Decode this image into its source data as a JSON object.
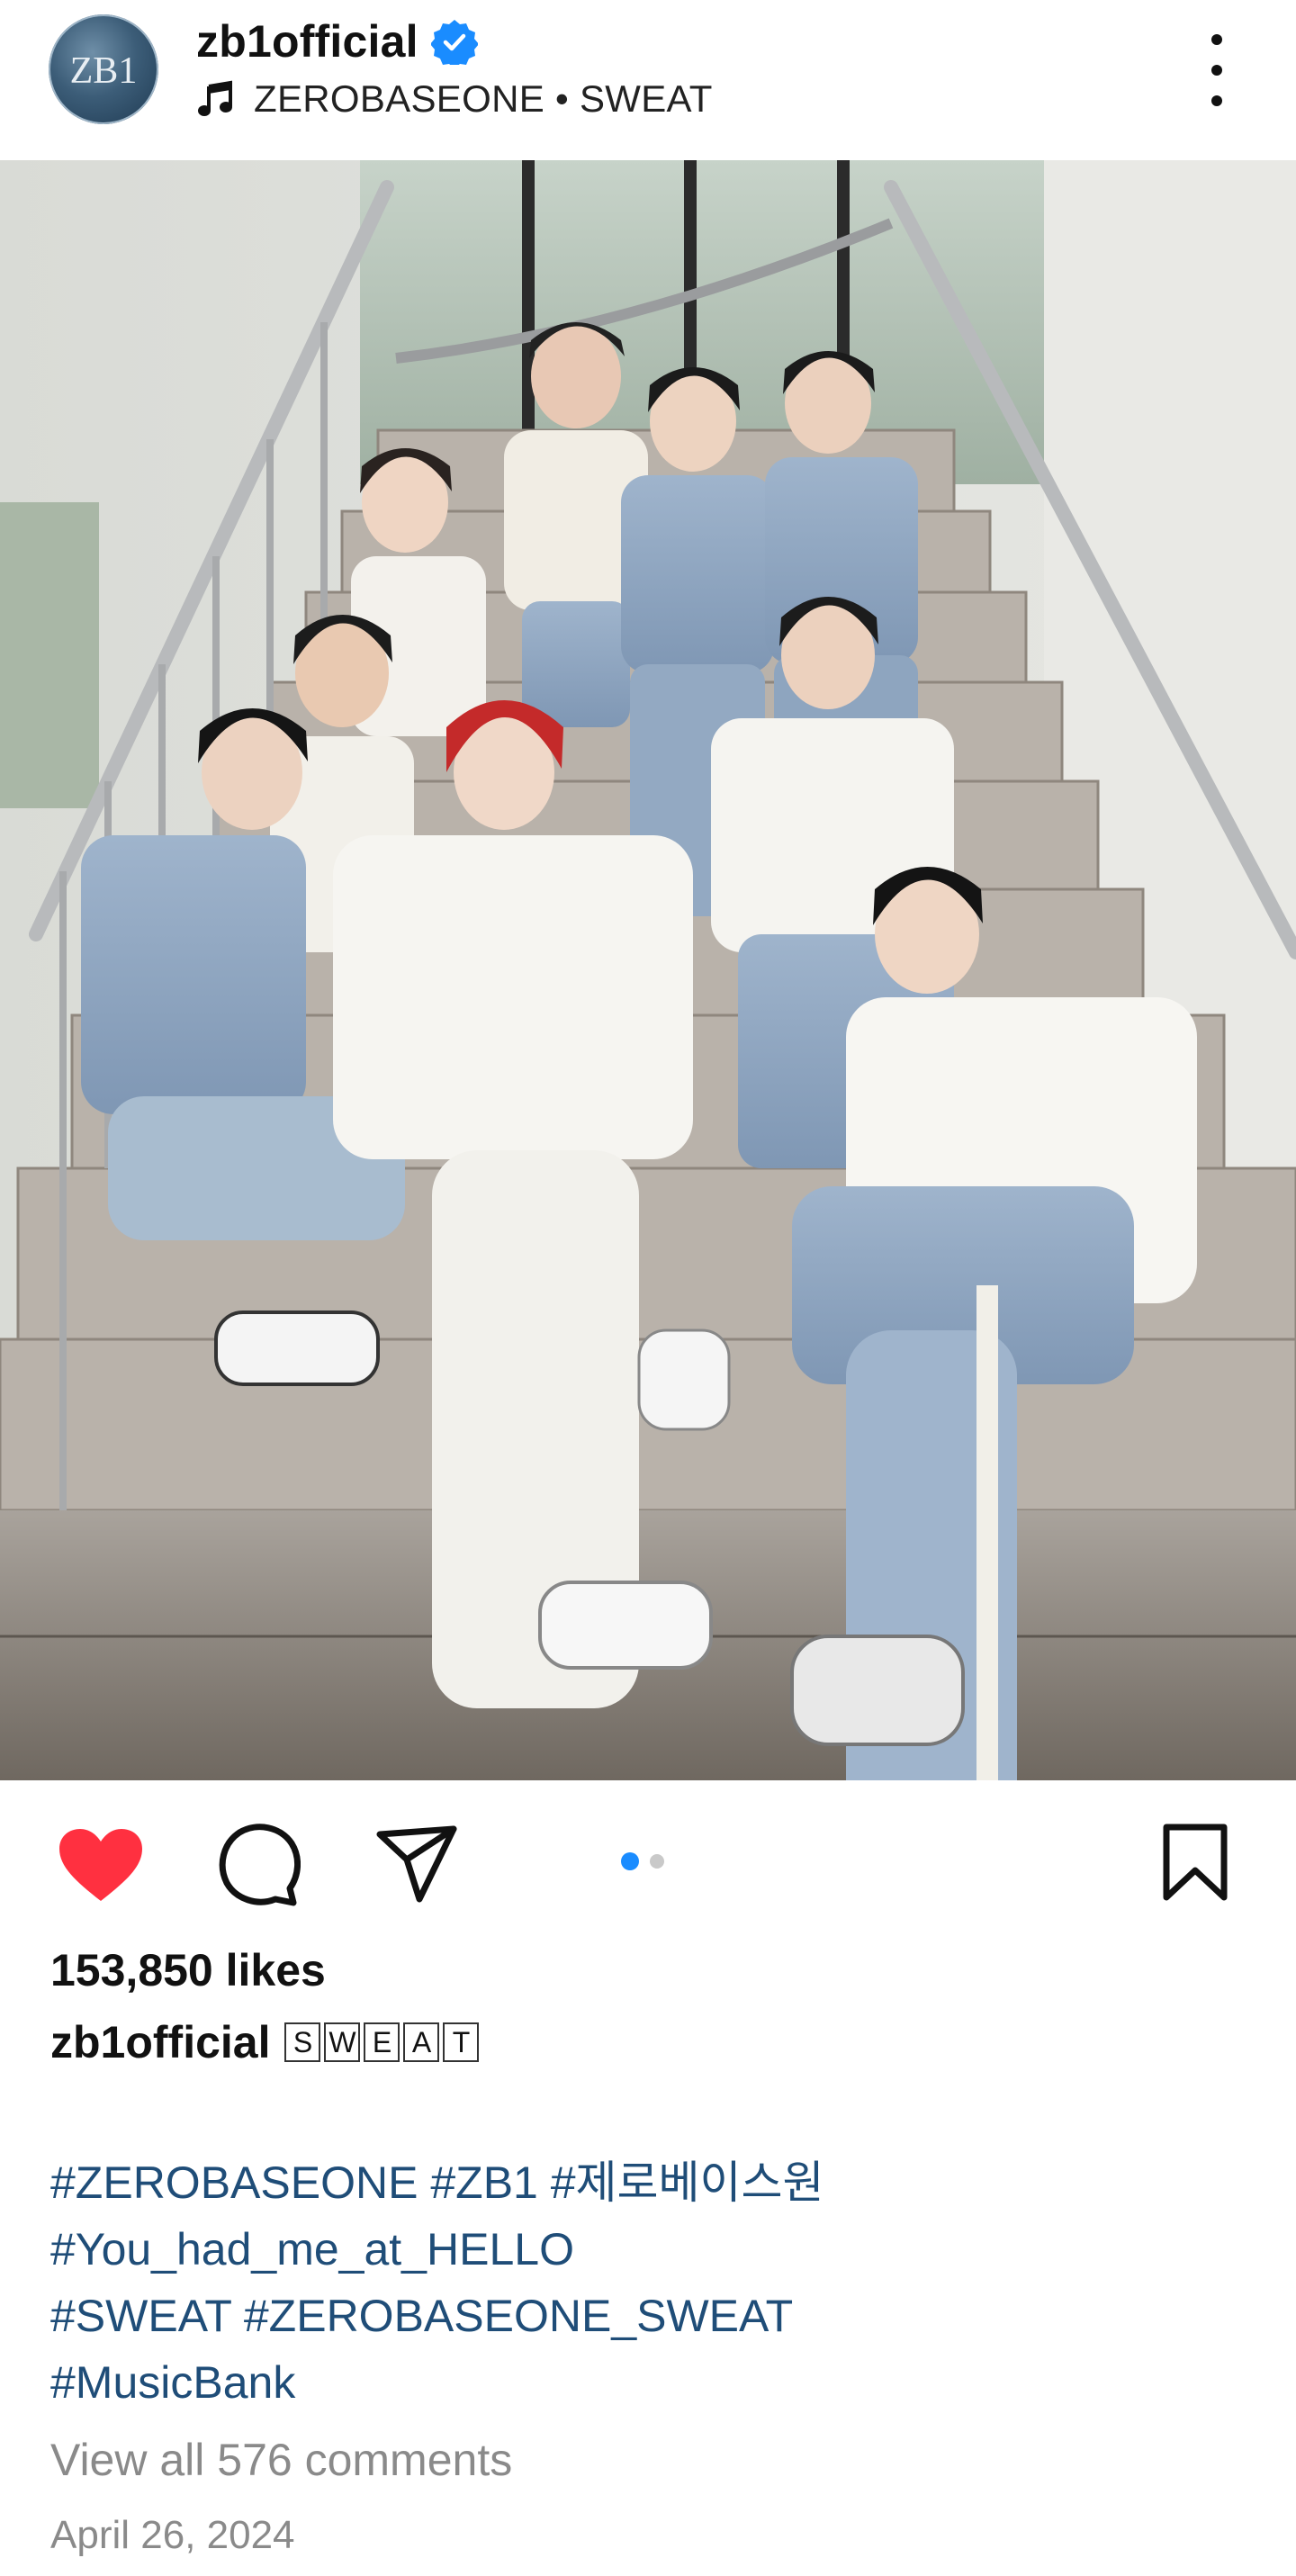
{
  "post": {
    "username": "zb1official",
    "music": "ZEROBASEONE • SWEAT",
    "avatar_label": "ZB1",
    "likes_text": "153,850 likes",
    "caption_user": "zb1official",
    "caption_boxed": [
      "S",
      "W",
      "E",
      "A",
      "T"
    ],
    "hashtag_lines": [
      "#ZEROBASEONE #ZB1 #제로베이스원",
      "#You_had_me_at_HELLO",
      "#SWEAT #ZEROBASEONE_SWEAT",
      "#MusicBank"
    ],
    "view_comments": "View all 576 comments",
    "date": "April 26, 2024"
  },
  "icons": {
    "verified": "verified-badge-icon",
    "music": "music-note-icon",
    "more": "more-options-icon",
    "sound": "sound-on-icon",
    "like": "heart-filled-icon",
    "comment": "comment-icon",
    "share": "share-icon",
    "bookmark": "bookmark-icon"
  },
  "carousel": {
    "total": 2,
    "active": 1
  },
  "colors": {
    "like_red": "#ff3040",
    "verified_blue": "#1a8cff",
    "hashtag_blue": "#1f4d78",
    "muted_gray": "#8a8a8a"
  }
}
